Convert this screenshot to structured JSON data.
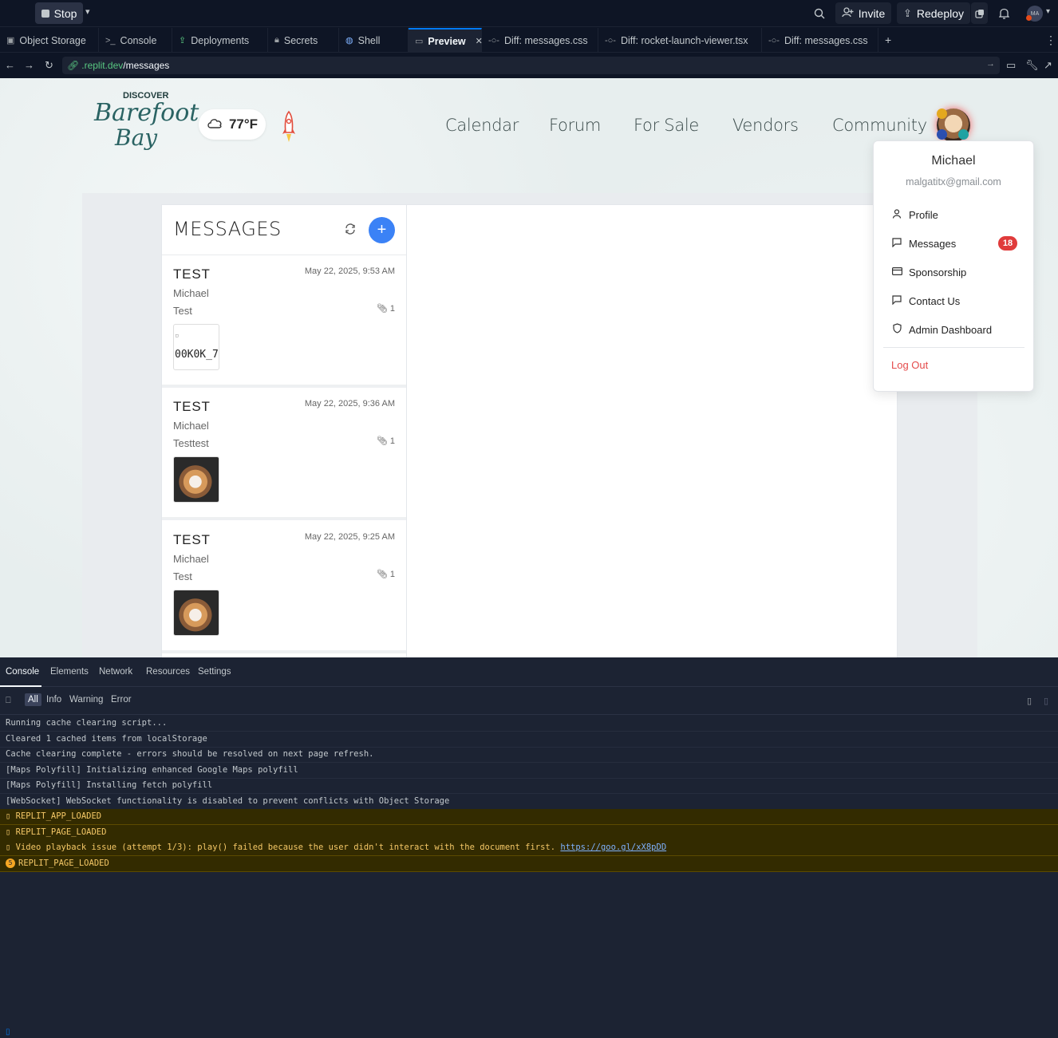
{
  "topbar": {
    "stop_label": "Stop",
    "invite_label": "Invite",
    "redeploy_label": "Redeploy",
    "user_initials": "MA"
  },
  "tabs": [
    {
      "label": "Object Storage",
      "icon": "storage-icon"
    },
    {
      "label": "Console",
      "icon": "terminal-icon"
    },
    {
      "label": "Deployments",
      "icon": "deploy-icon"
    },
    {
      "label": "Secrets",
      "icon": "lock-icon"
    },
    {
      "label": "Shell",
      "icon": "shell-icon"
    },
    {
      "label": "Preview",
      "icon": "monitor-icon",
      "active": true
    },
    {
      "label": "Diff: messages.css",
      "icon": "diff-icon"
    },
    {
      "label": "Diff: rocket-launch-viewer.tsx",
      "icon": "diff-icon"
    },
    {
      "label": "Diff: messages.css",
      "icon": "diff-icon"
    }
  ],
  "address": {
    "domain": ".replit.dev",
    "path": "/messages"
  },
  "site": {
    "logo": {
      "top": "DISCOVER",
      "line1": "Barefoot",
      "line2": "Bay"
    },
    "weather_temp": "77°F",
    "nav": [
      "Calendar",
      "Forum",
      "For Sale",
      "Vendors",
      "Community"
    ]
  },
  "messages": {
    "title": "MESSAGES",
    "items": [
      {
        "subject": "TEST",
        "date": "May 22, 2025, 9:53 AM",
        "from": "Michael",
        "body": "Test",
        "attachments": "1",
        "thumb_alt": "00K0K_7"
      },
      {
        "subject": "TEST",
        "date": "May 22, 2025, 9:36 AM",
        "from": "Michael",
        "body": "Testtest",
        "attachments": "1"
      },
      {
        "subject": "TEST",
        "date": "May 22, 2025, 9:25 AM",
        "from": "Michael",
        "body": "Test",
        "attachments": "1"
      }
    ]
  },
  "user_menu": {
    "name": "Michael",
    "email": "malgatitx@gmail.com",
    "items": [
      {
        "label": "Profile",
        "icon": "person-icon"
      },
      {
        "label": "Messages",
        "icon": "chat-icon",
        "badge": "18"
      },
      {
        "label": "Sponsorship",
        "icon": "card-icon"
      },
      {
        "label": "Contact Us",
        "icon": "chat-icon"
      },
      {
        "label": "Admin Dashboard",
        "icon": "shield-icon"
      }
    ],
    "logout": "Log Out"
  },
  "devtools": {
    "tabs": [
      "Console",
      "Elements",
      "Network",
      "Resources",
      "Settings"
    ],
    "filters": [
      "All",
      "Info",
      "Warning",
      "Error"
    ],
    "logs": [
      {
        "text": "Running cache clearing script...",
        "level": "info"
      },
      {
        "text": "Cleared 1 cached items from localStorage",
        "level": "info"
      },
      {
        "text": "Cache clearing complete - errors should be resolved on next page refresh.",
        "level": "info"
      },
      {
        "text": "[Maps Polyfill] Initializing enhanced Google Maps polyfill",
        "level": "info"
      },
      {
        "text": "[Maps Polyfill] Installing fetch polyfill",
        "level": "info"
      },
      {
        "text": "[WebSocket] WebSocket functionality is disabled to prevent conflicts with Object Storage",
        "level": "info"
      },
      {
        "text": "REPLIT_APP_LOADED",
        "level": "warn"
      },
      {
        "text": "REPLIT_PAGE_LOADED",
        "level": "warn"
      },
      {
        "text": "Video playback issue (attempt 1/3): play() failed because the user didn't interact with the document first.",
        "level": "warn",
        "link": "https://goo.gl/xX8pDD"
      },
      {
        "text": "REPLIT_PAGE_LOADED",
        "level": "warn",
        "count": "5"
      }
    ]
  },
  "colors": {
    "ide_bg": "#0e1525",
    "accent": "#0079f2",
    "primary_button": "#3b82f6",
    "badge_red": "#e03b3b",
    "logout_red": "#e44b4b",
    "warn_bg": "#332b00"
  }
}
